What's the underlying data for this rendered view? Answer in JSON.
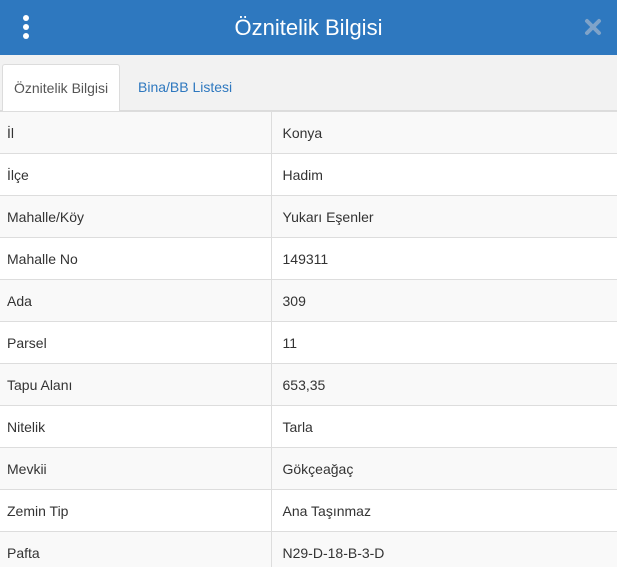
{
  "header": {
    "title": "Öznitelik Bilgisi",
    "menu_icon": "vertical-dots-icon",
    "close_icon": "close-icon",
    "background_color": "#2e78bf"
  },
  "tabs": [
    {
      "label": "Öznitelik Bilgisi",
      "active": true
    },
    {
      "label": "Bina/BB Listesi",
      "active": false
    }
  ],
  "attributes": [
    {
      "label": "İl",
      "value": "Konya"
    },
    {
      "label": "İlçe",
      "value": "Hadim"
    },
    {
      "label": "Mahalle/Köy",
      "value": "Yukarı Eşenler"
    },
    {
      "label": "Mahalle No",
      "value": "149311"
    },
    {
      "label": "Ada",
      "value": "309"
    },
    {
      "label": "Parsel",
      "value": "11"
    },
    {
      "label": "Tapu Alanı",
      "value": "653,35"
    },
    {
      "label": "Nitelik",
      "value": "Tarla"
    },
    {
      "label": "Mevkii",
      "value": "Gökçeağaç"
    },
    {
      "label": "Zemin Tip",
      "value": "Ana Taşınmaz"
    },
    {
      "label": "Pafta",
      "value": "N29-D-18-B-3-D"
    }
  ]
}
